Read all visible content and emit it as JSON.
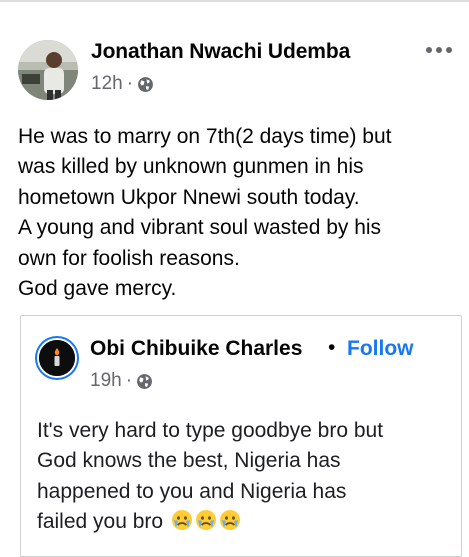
{
  "post": {
    "author": "Jonathan Nwachi Udemba",
    "time": "12h",
    "separator": "·",
    "privacy_icon": "globe-icon",
    "more_icon": "more-options-icon",
    "text_lines": [
      "He was to marry on 7th(2 days time) but",
      "was killed by unknown gunmen in his",
      "hometown Ukpor Nnewi south today.",
      "A young and vibrant soul wasted by his",
      "own for foolish reasons.",
      "God gave mercy."
    ]
  },
  "shared_post": {
    "author": "Obi Chibuike Charles",
    "separator": "•",
    "follow_label": "Follow",
    "time": "19h",
    "time_separator": "·",
    "privacy_icon": "globe-icon",
    "text_lines": [
      "It's very hard to type goodbye bro but",
      "God knows the best, Nigeria has",
      "happened to you and Nigeria has",
      "failed you bro"
    ],
    "emoji": "crying-face-emoji",
    "emoji_count": 3
  },
  "colors": {
    "link_blue": "#1877f2",
    "meta_gray": "#65676b",
    "text": "#050505"
  }
}
